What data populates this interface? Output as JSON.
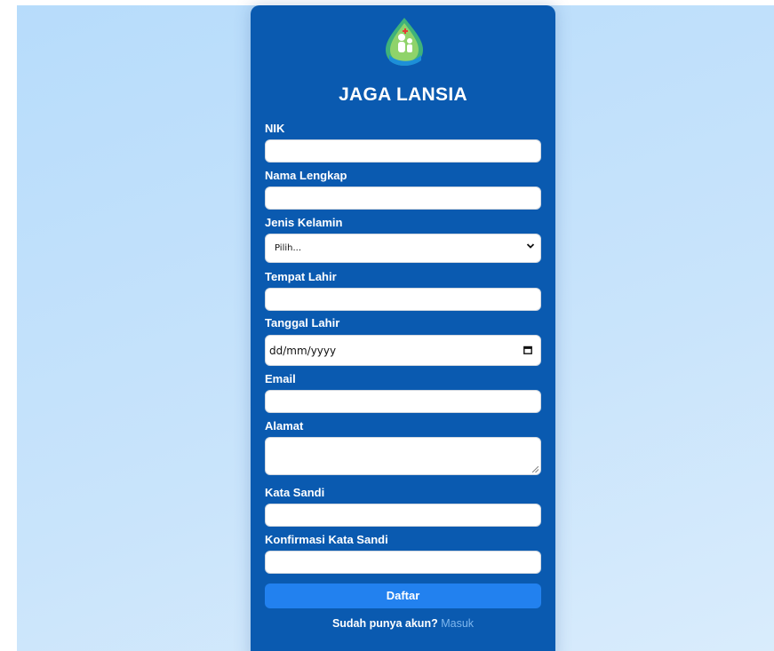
{
  "app": {
    "title": "JAGA LANSIA"
  },
  "form": {
    "nik": {
      "label": "NIK",
      "value": ""
    },
    "nama": {
      "label": "Nama Lengkap",
      "value": ""
    },
    "jenis_kelamin": {
      "label": "Jenis Kelamin",
      "selected": "Pilih..."
    },
    "tempat_lahir": {
      "label": "Tempat Lahir",
      "value": ""
    },
    "tanggal_lahir": {
      "label": "Tanggal Lahir",
      "placeholder": "dd/mm/yyyy"
    },
    "email": {
      "label": "Email",
      "value": ""
    },
    "alamat": {
      "label": "Alamat",
      "value": ""
    },
    "kata_sandi": {
      "label": "Kata Sandi",
      "value": ""
    },
    "konfirmasi": {
      "label": "Konfirmasi Kata Sandi",
      "value": ""
    },
    "submit_label": "Daftar"
  },
  "footer": {
    "prompt": "Sudah punya akun?",
    "link_label": "Masuk"
  },
  "icons": {
    "logo": "leaf-drop-elderly-care-logo",
    "select": "chevron-down-icon",
    "date": "calendar-icon"
  },
  "colors": {
    "card": "#0a5ab0",
    "button": "#2281ef",
    "link": "#7fb7ee",
    "background": "#c9e4fb"
  }
}
